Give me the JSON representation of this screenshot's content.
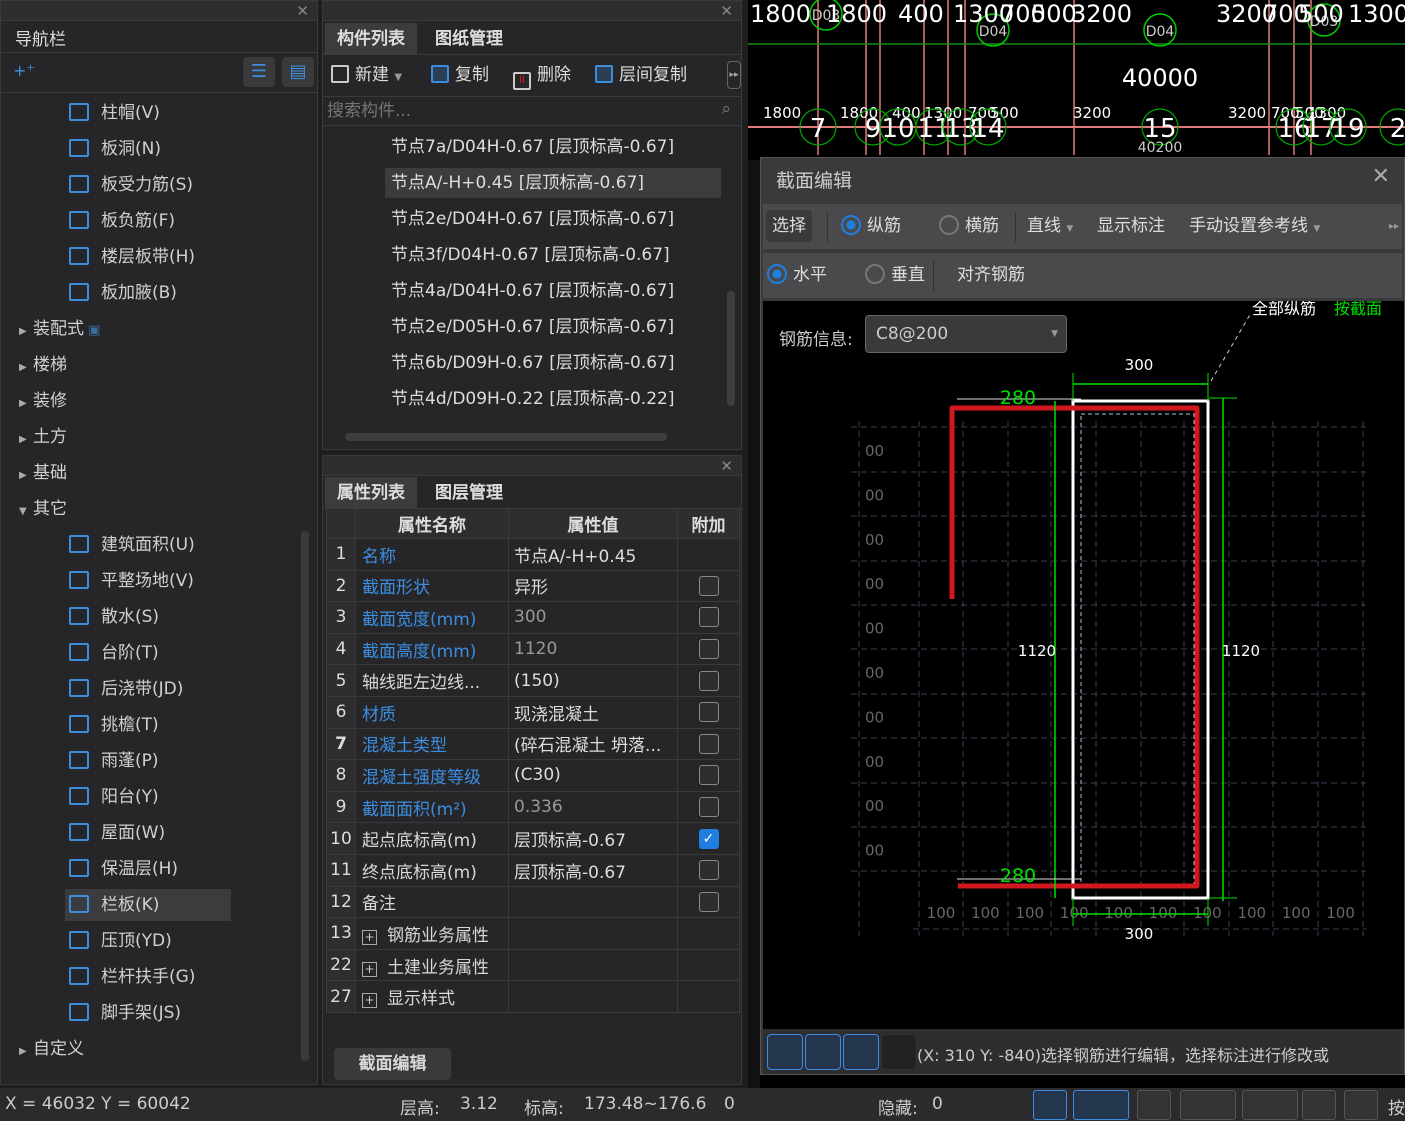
{
  "nav": {
    "title": "导航栏",
    "items": [
      {
        "label": "柱帽(V)",
        "icon": "column-cap-icon"
      },
      {
        "label": "板洞(N)",
        "icon": "slab-hole-icon"
      },
      {
        "label": "板受力筋(S)",
        "icon": "slab-rebar-icon"
      },
      {
        "label": "板负筋(F)",
        "icon": "slab-negative-rebar-icon"
      },
      {
        "label": "楼层板带(H)",
        "icon": "slab-strip-icon"
      },
      {
        "label": "板加腋(B)",
        "icon": "slab-haunch-icon"
      }
    ],
    "groups_mid": [
      "装配式",
      "楼梯",
      "装修",
      "土方",
      "基础"
    ],
    "group_open": "其它",
    "other_items": [
      {
        "label": "建筑面积(U)",
        "icon": "building-area-icon"
      },
      {
        "label": "平整场地(V)",
        "icon": "site-leveling-icon"
      },
      {
        "label": "散水(S)",
        "icon": "apron-icon"
      },
      {
        "label": "台阶(T)",
        "icon": "steps-icon"
      },
      {
        "label": "后浇带(JD)",
        "icon": "post-cast-strip-icon"
      },
      {
        "label": "挑檐(T)",
        "icon": "eave-icon"
      },
      {
        "label": "雨蓬(P)",
        "icon": "canopy-icon"
      },
      {
        "label": "阳台(Y)",
        "icon": "balcony-icon"
      },
      {
        "label": "屋面(W)",
        "icon": "roof-icon"
      },
      {
        "label": "保温层(H)",
        "icon": "insulation-icon"
      },
      {
        "label": "栏板(K)",
        "icon": "parapet-icon",
        "selected": true
      },
      {
        "label": "压顶(YD)",
        "icon": "coping-icon"
      },
      {
        "label": "栏杆扶手(G)",
        "icon": "railing-icon"
      },
      {
        "label": "脚手架(JS)",
        "icon": "scaffold-icon"
      }
    ],
    "group_last": "自定义"
  },
  "components": {
    "tabs": [
      "构件列表",
      "图纸管理"
    ],
    "toolbar": {
      "new": "新建",
      "copy": "复制",
      "delete": "删除",
      "floor_copy": "层间复制"
    },
    "search_placeholder": "搜索构件...",
    "items": [
      "节点7a/D04H-0.67 [层顶标高-0.67]",
      "节点A/-H+0.45 [层顶标高-0.67]",
      "节点2e/D04H-0.67 [层顶标高-0.67]",
      "节点3f/D04H-0.67 [层顶标高-0.67]",
      "节点4a/D04H-0.67 [层顶标高-0.67]",
      "节点2e/D05H-0.67 [层顶标高-0.67]",
      "节点6b/D09H-0.67 [层顶标高-0.67]",
      "节点4d/D09H-0.22 [层顶标高-0.22]"
    ],
    "selected_index": 1
  },
  "properties": {
    "tabs": [
      "属性列表",
      "图层管理"
    ],
    "headers": [
      "属性名称",
      "属性值",
      "附加"
    ],
    "rows": [
      {
        "n": "1",
        "name": "名称",
        "value": "节点A/-H+0.45",
        "blue": true,
        "check": null
      },
      {
        "n": "2",
        "name": "截面形状",
        "value": "异形",
        "blue": true,
        "check": false
      },
      {
        "n": "3",
        "name": "截面宽度(mm)",
        "value": "300",
        "blue": true,
        "check": false,
        "ro": true
      },
      {
        "n": "4",
        "name": "截面高度(mm)",
        "value": "1120",
        "blue": true,
        "check": false,
        "ro": true
      },
      {
        "n": "5",
        "name": "轴线距左边线...",
        "value": "(150)",
        "blue": false,
        "check": false
      },
      {
        "n": "6",
        "name": "材质",
        "value": "现浇混凝土",
        "blue": true,
        "check": false
      },
      {
        "n": "7",
        "name": "混凝土类型",
        "value": "(碎石混凝土 坍落...",
        "blue": true,
        "check": false
      },
      {
        "n": "8",
        "name": "混凝土强度等级",
        "value": "(C30)",
        "blue": true,
        "check": false
      },
      {
        "n": "9",
        "name": "截面面积(m²)",
        "value": "0.336",
        "blue": true,
        "check": false,
        "ro": true
      },
      {
        "n": "10",
        "name": "起点底标高(m)",
        "value": "层顶标高-0.67",
        "blue": false,
        "check": true
      },
      {
        "n": "11",
        "name": "终点底标高(m)",
        "value": "层顶标高-0.67",
        "blue": false,
        "check": false
      },
      {
        "n": "12",
        "name": "备注",
        "value": "",
        "blue": false,
        "check": false
      },
      {
        "n": "13",
        "name": "钢筋业务属性",
        "value": "",
        "blue": false,
        "check": null,
        "expand": true
      },
      {
        "n": "22",
        "name": "土建业务属性",
        "value": "",
        "blue": false,
        "check": null,
        "expand": true
      },
      {
        "n": "27",
        "name": "显示样式",
        "value": "",
        "blue": false,
        "check": null,
        "expand": true
      }
    ],
    "footer_button": "截面编辑"
  },
  "cad": {
    "top_dims": [
      "1800",
      "1800",
      "400",
      "1300",
      "700",
      "500",
      "3200",
      "3200",
      "700",
      "500",
      "1300"
    ],
    "total": "40000",
    "sub_total": "40200",
    "row_dims": [
      "1800",
      "1800",
      "400",
      "1300",
      "700",
      "500",
      "3200",
      "3200",
      "700",
      "500",
      "1300"
    ],
    "axes": [
      "7",
      "9",
      "10",
      "11",
      "13",
      "14",
      "15",
      "16",
      "17",
      "19",
      "2"
    ],
    "circle_labels": [
      "D03",
      "D04",
      "D04",
      "D03"
    ]
  },
  "section_editor": {
    "title": "截面编辑",
    "toolbar1": {
      "select": "选择",
      "longitudinal": "纵筋",
      "transverse": "横筋",
      "line": "直线",
      "show_dims": "显示标注",
      "manual_ref": "手动设置参考线"
    },
    "rebar_mode": "longitudinal",
    "toolbar2": {
      "horizontal": "水平",
      "vertical": "垂直",
      "align": "对齐钢筋"
    },
    "align_mode": "horizontal",
    "rebar_info_label": "钢筋信息:",
    "rebar_info_value": "C8@200",
    "annotation": {
      "all": "全部纵筋",
      "by_section": "按截面"
    },
    "dims": {
      "width_top": "300",
      "width_bottom": "300",
      "height_left": "1120",
      "height_right": "1120",
      "leg_top": "280",
      "leg_bottom": "280",
      "grid": "100",
      "grid_left": "00"
    },
    "status_text": "(X: 310 Y: -840)选择钢筋进行编辑，选择标注进行修改或"
  },
  "status": {
    "coords": "X = 46032 Y = 60042",
    "floor_height_label": "层高:",
    "floor_height": "3.12",
    "elev_label": "标高:",
    "elev": "173.48~176.6",
    "zero": "0",
    "hidden_label": "隐藏:",
    "hidden": "0",
    "more": "按"
  },
  "colors": {
    "accent": "#3c8de0",
    "rebar": "#d0181e",
    "dim": "#00e000",
    "outline": "#ffffff"
  }
}
